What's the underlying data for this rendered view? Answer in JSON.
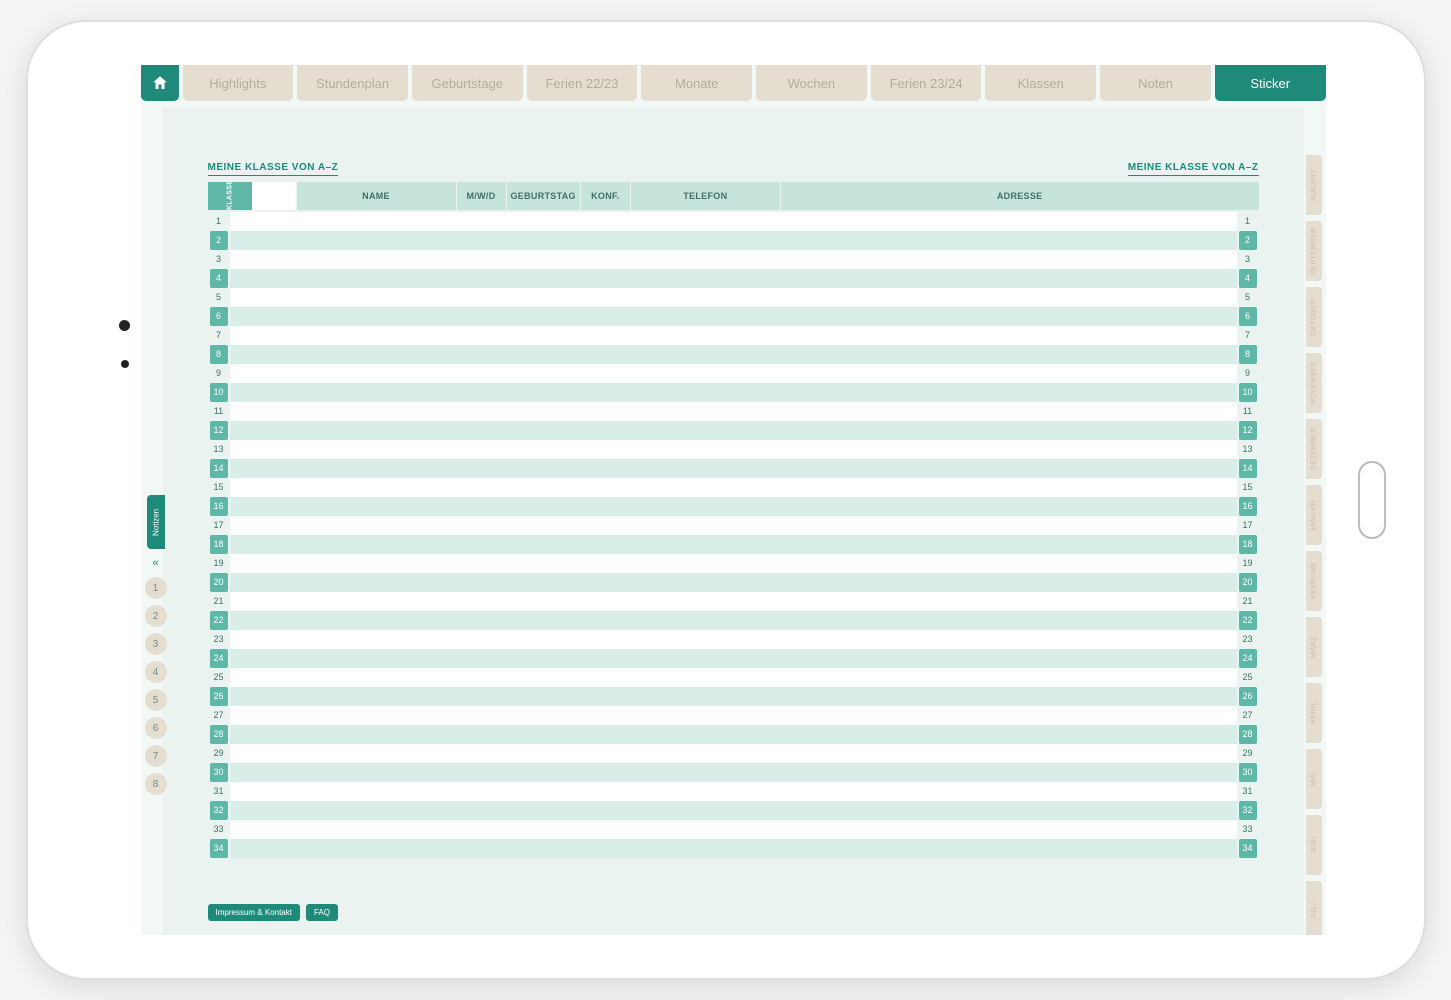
{
  "top_tabs": [
    {
      "label": "",
      "home": true
    },
    {
      "label": "Highlights"
    },
    {
      "label": "Stundenplan"
    },
    {
      "label": "Geburtstage"
    },
    {
      "label": "Ferien 22/23"
    },
    {
      "label": "Monate"
    },
    {
      "label": "Wochen"
    },
    {
      "label": "Ferien 23/24"
    },
    {
      "label": "Klassen"
    },
    {
      "label": "Noten"
    },
    {
      "label": "Sticker",
      "active": true
    }
  ],
  "section_title_left": "MEINE KLASSE VON A–Z",
  "section_title_right": "MEINE KLASSE VON A–Z",
  "table_header": {
    "klasse": "KLASSE",
    "name": "NAME",
    "mwd": "M/W/D",
    "birth": "GEBURTSTAG",
    "konf": "KONF.",
    "tel": "TELEFON",
    "addr": "ADRESSE"
  },
  "row_count": 34,
  "footer": {
    "impressum": "Impressum & Kontakt",
    "faq": "FAQ"
  },
  "month_tabs": [
    "AUGUST",
    "SEPTEMBER",
    "OKTOBER",
    "NOVEMBER",
    "DEZEMBER",
    "JANUAR",
    "FEBRUAR",
    "MÄRZ",
    "APRIL",
    "MAI",
    "JUNI",
    "JULI"
  ],
  "left": {
    "notizen": "Notizen",
    "numbers": [
      "1",
      "2",
      "3",
      "4",
      "5",
      "6",
      "7",
      "8"
    ]
  }
}
